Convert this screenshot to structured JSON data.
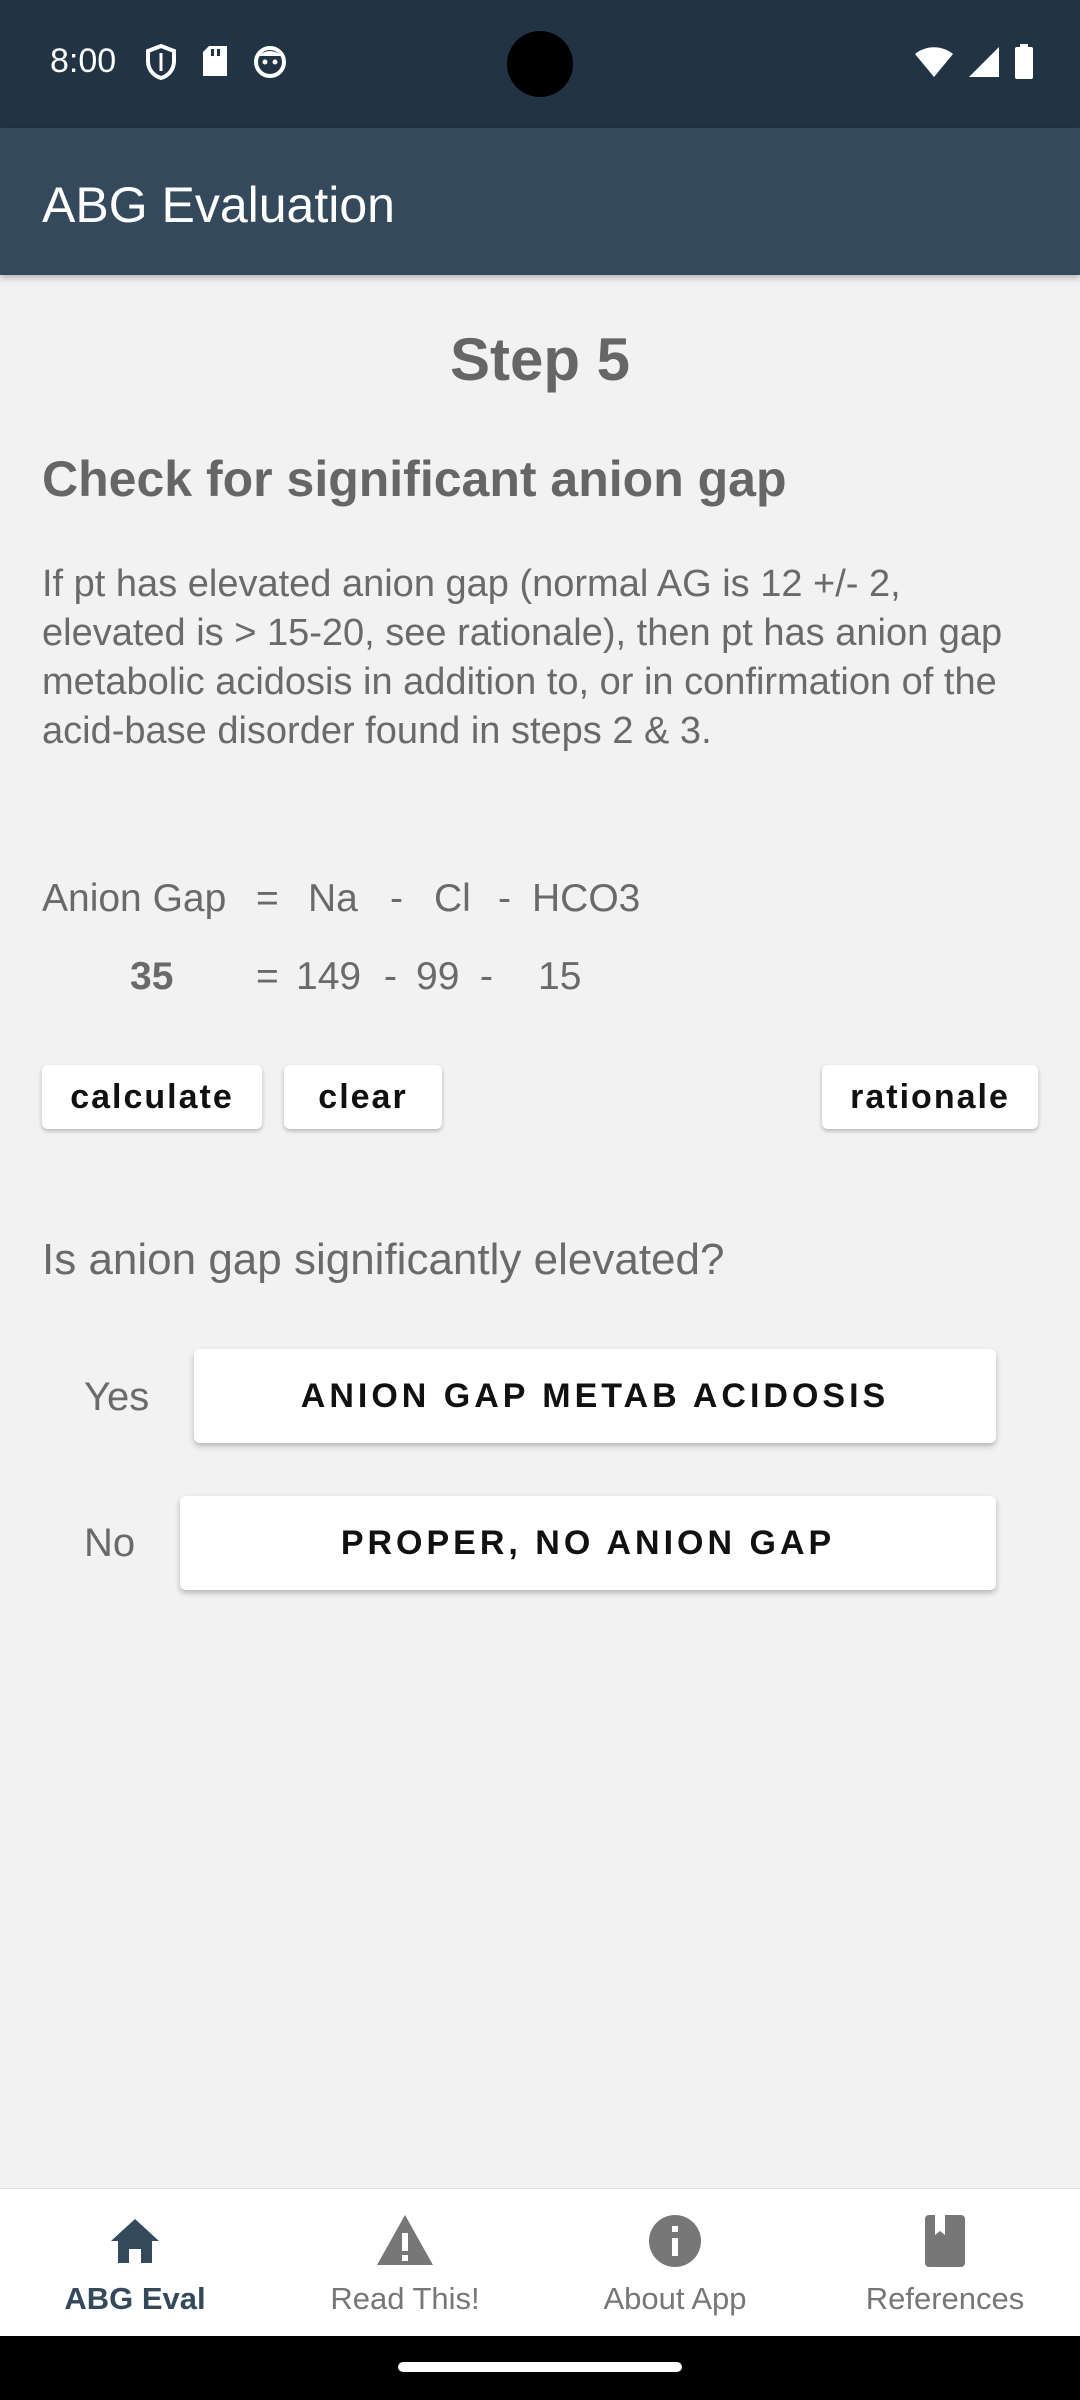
{
  "status_bar": {
    "time": "8:00",
    "left_icons": [
      "shield-icon",
      "sd-card-icon",
      "face-icon"
    ],
    "right_icons": [
      "wifi-icon",
      "signal-icon",
      "battery-icon"
    ]
  },
  "app_bar": {
    "title": "ABG Evaluation"
  },
  "step": {
    "title": "Step 5",
    "heading": "Check for significant anion gap",
    "description": "If pt has elevated anion gap (normal AG is 12 +/- 2, elevated is > 15-20, see rationale), then pt has anion gap metabolic acidosis in addition to, or in confirmation of the acid-base disorder found in steps 2 & 3."
  },
  "formula": {
    "label": "Anion Gap",
    "eq": "=",
    "na_label": "Na",
    "minus": "-",
    "cl_label": "Cl",
    "hco3_label": "HCO3",
    "result": "35",
    "na_value": "149",
    "cl_value": "99",
    "hco3_value": "15"
  },
  "buttons": {
    "calculate": "calculate",
    "clear": "clear",
    "rationale": "rationale"
  },
  "question": {
    "text": "Is anion gap significantly elevated?",
    "yes_label": "Yes",
    "yes_button": "ANION GAP METAB ACIDOSIS",
    "no_label": "No",
    "no_button": "PROPER, NO ANION GAP"
  },
  "bottom_nav": {
    "items": [
      {
        "label": "ABG Eval",
        "icon": "home-icon",
        "active": true
      },
      {
        "label": "Read This!",
        "icon": "warning-icon",
        "active": false
      },
      {
        "label": "About App",
        "icon": "info-icon",
        "active": false
      },
      {
        "label": "References",
        "icon": "book-icon",
        "active": false
      }
    ]
  },
  "colors": {
    "status_bar": "#223344",
    "app_bar": "#344a5c",
    "background": "#f2f2f2",
    "text_gray": "#6a6a6a",
    "nav_active": "#344a5c"
  }
}
